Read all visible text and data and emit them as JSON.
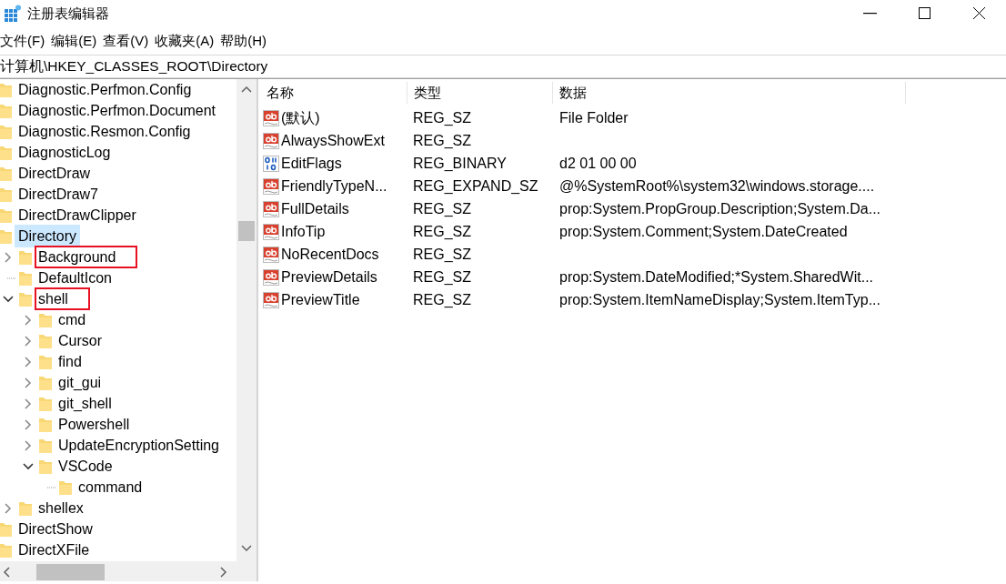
{
  "window": {
    "title": "注册表编辑器"
  },
  "menu": [
    "文件(F)",
    "编辑(E)",
    "查看(V)",
    "收藏夹(A)",
    "帮助(H)"
  ],
  "address": "计算机\\HKEY_CLASSES_ROOT\\Directory",
  "tree": [
    {
      "label": "Diagnostic.Perfmon.Config",
      "selected": false,
      "highlighted": false
    },
    {
      "label": "Diagnostic.Perfmon.Document",
      "selected": false,
      "highlighted": false
    },
    {
      "label": "Diagnostic.Resmon.Config",
      "selected": false,
      "highlighted": false
    },
    {
      "label": "DiagnosticLog",
      "selected": false,
      "highlighted": false
    },
    {
      "label": "DirectDraw",
      "selected": false,
      "highlighted": false
    },
    {
      "label": "DirectDraw7",
      "selected": false,
      "highlighted": false
    },
    {
      "label": "DirectDrawClipper",
      "selected": false,
      "highlighted": false
    },
    {
      "label": "Directory",
      "selected": true,
      "highlighted": false,
      "children": [
        {
          "label": "Background",
          "kind": "collapsed",
          "selected": false,
          "highlighted": true
        },
        {
          "label": "DefaultIcon",
          "kind": "leaf",
          "selected": false,
          "highlighted": false
        },
        {
          "label": "shell",
          "kind": "expanded",
          "selected": false,
          "highlighted": true,
          "children": [
            {
              "label": "cmd",
              "kind": "collapsed",
              "selected": false,
              "highlighted": false
            },
            {
              "label": "Cursor",
              "kind": "collapsed",
              "selected": false,
              "highlighted": false
            },
            {
              "label": "find",
              "kind": "collapsed",
              "selected": false,
              "highlighted": false
            },
            {
              "label": "git_gui",
              "kind": "collapsed",
              "selected": false,
              "highlighted": false
            },
            {
              "label": "git_shell",
              "kind": "collapsed",
              "selected": false,
              "highlighted": false
            },
            {
              "label": "Powershell",
              "kind": "collapsed",
              "selected": false,
              "highlighted": false
            },
            {
              "label": "UpdateEncryptionSetting",
              "kind": "collapsed",
              "selected": false,
              "highlighted": false
            },
            {
              "label": "VSCode",
              "kind": "expanded",
              "selected": false,
              "highlighted": false,
              "children": [
                {
                  "label": "command",
                  "kind": "leaf",
                  "selected": false,
                  "highlighted": false
                }
              ]
            }
          ]
        },
        {
          "label": "shellex",
          "kind": "collapsed",
          "selected": false,
          "highlighted": false
        }
      ]
    },
    {
      "label": "DirectShow",
      "selected": false,
      "highlighted": false
    },
    {
      "label": "DirectXFile",
      "selected": false,
      "highlighted": false
    }
  ],
  "table": {
    "columns": [
      "名称",
      "类型",
      "数据"
    ],
    "rows": [
      {
        "name": "(默认)",
        "kind": "string",
        "type": "REG_SZ",
        "data": "File Folder"
      },
      {
        "name": "AlwaysShowExt",
        "kind": "string",
        "type": "REG_SZ",
        "data": ""
      },
      {
        "name": "EditFlags",
        "kind": "binary",
        "type": "REG_BINARY",
        "data": "d2 01 00 00"
      },
      {
        "name": "FriendlyTypeN...",
        "kind": "string",
        "type": "REG_EXPAND_SZ",
        "data": "@%SystemRoot%\\system32\\windows.storage...."
      },
      {
        "name": "FullDetails",
        "kind": "string",
        "type": "REG_SZ",
        "data": "prop:System.PropGroup.Description;System.Da..."
      },
      {
        "name": "InfoTip",
        "kind": "string",
        "type": "REG_SZ",
        "data": "prop:System.Comment;System.DateCreated"
      },
      {
        "name": "NoRecentDocs",
        "kind": "string",
        "type": "REG_SZ",
        "data": ""
      },
      {
        "name": "PreviewDetails",
        "kind": "string",
        "type": "REG_SZ",
        "data": "prop:System.DateModified;*System.SharedWit..."
      },
      {
        "name": "PreviewTitle",
        "kind": "string",
        "type": "REG_SZ",
        "data": "prop:System.ItemNameDisplay;System.ItemTyp..."
      }
    ]
  }
}
